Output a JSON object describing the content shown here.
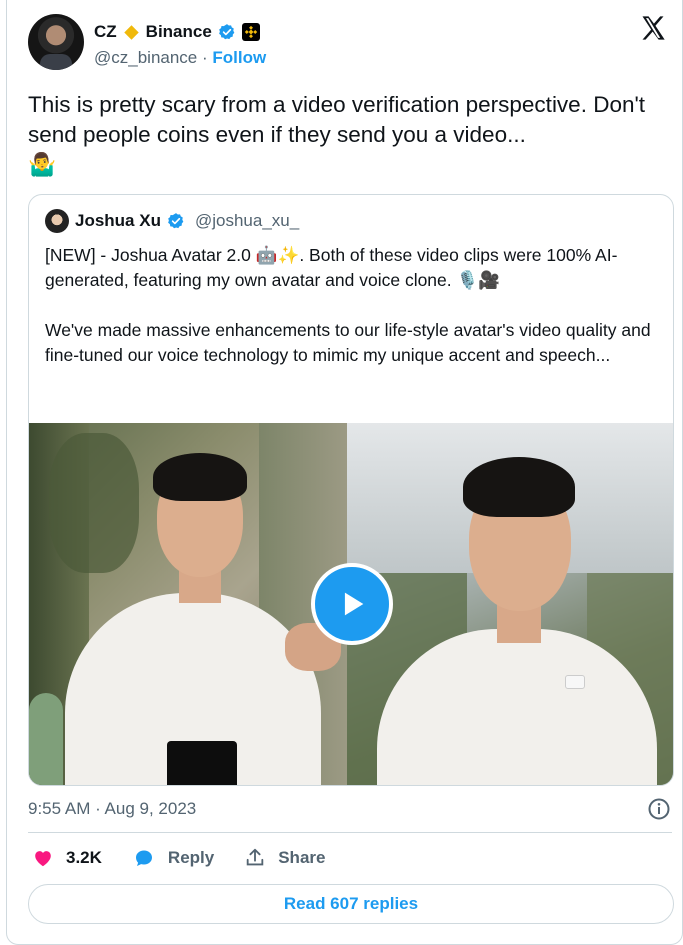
{
  "author": {
    "name": "CZ",
    "org": "Binance",
    "handle": "@cz_binance",
    "separator": "·",
    "follow_label": "Follow"
  },
  "tweet": {
    "text": "This is pretty scary from a video verification perspective. Don't send people coins even if they send you a video...",
    "emoji": "🤷‍♂️"
  },
  "quoted": {
    "name": "Joshua Xu",
    "handle": "@joshua_xu_",
    "para1": "[NEW] - Joshua Avatar 2.0 🤖✨. Both of these video clips were 100% AI-generated, featuring my own avatar and voice clone. 🎙️🎥",
    "para2": "We've made massive enhancements to our life-style avatar's video quality and fine-tuned our voice technology to mimic my unique accent and speech..."
  },
  "meta": {
    "timestamp": "9:55 AM · Aug 9, 2023"
  },
  "actions": {
    "likes": "3.2K",
    "reply": "Reply",
    "share": "Share"
  },
  "read_replies": "Read 607 replies",
  "colors": {
    "accent": "#1d9bf0",
    "like": "#f91880",
    "binance": "#f0b90b"
  },
  "icons": [
    "x-logo-icon",
    "verified-badge-icon",
    "binance-diamond-icon",
    "play-icon",
    "info-icon",
    "heart-icon",
    "reply-bubble-icon",
    "share-icon"
  ]
}
